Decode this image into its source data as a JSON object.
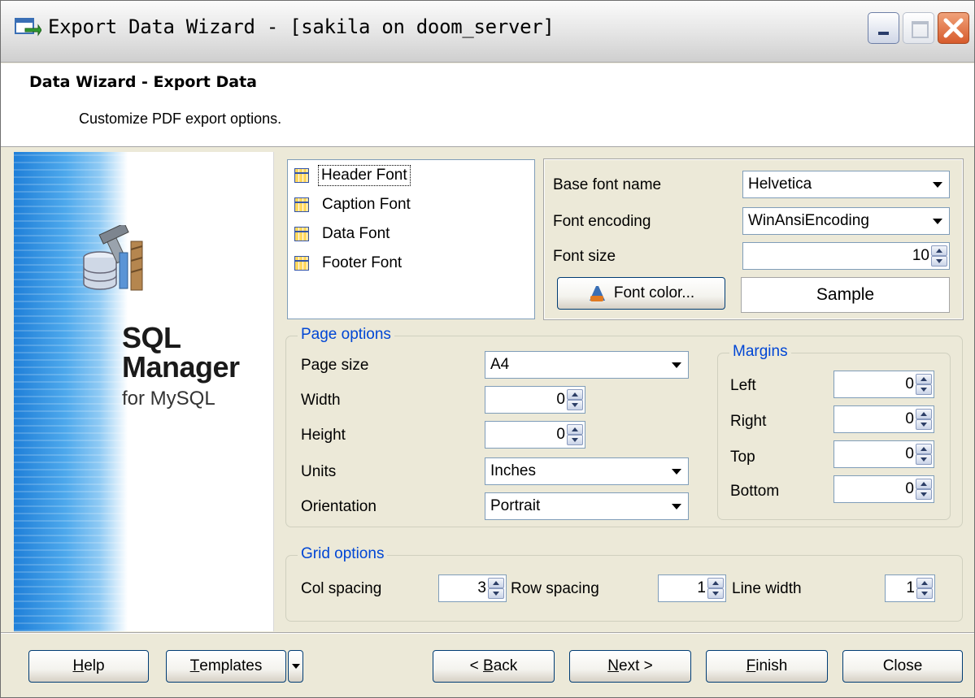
{
  "window": {
    "title": "Export Data Wizard - [sakila on doom_server]"
  },
  "header": {
    "title": "Data Wizard - Export Data",
    "subtitle": "Customize PDF export options."
  },
  "side_panel": {
    "product_line1": "SQL",
    "product_line2": "Manager",
    "product_line3": "for MySQL"
  },
  "font_list": {
    "items": [
      {
        "label": "Header Font",
        "selected": true
      },
      {
        "label": "Caption Font",
        "selected": false
      },
      {
        "label": "Data Font",
        "selected": false
      },
      {
        "label": "Footer Font",
        "selected": false
      }
    ]
  },
  "font_settings": {
    "base_font_label": "Base font name",
    "base_font_value": "Helvetica",
    "encoding_label": "Font encoding",
    "encoding_value": "WinAnsiEncoding",
    "size_label": "Font size",
    "size_value": "10",
    "color_button": "Font color...",
    "sample": "Sample"
  },
  "page_options": {
    "caption": "Page options",
    "page_size_label": "Page size",
    "page_size_value": "A4",
    "width_label": "Width",
    "width_value": "0",
    "height_label": "Height",
    "height_value": "0",
    "units_label": "Units",
    "units_value": "Inches",
    "orientation_label": "Orientation",
    "orientation_value": "Portrait"
  },
  "margins": {
    "caption": "Margins",
    "left_label": "Left",
    "left_value": "0",
    "right_label": "Right",
    "right_value": "0",
    "top_label": "Top",
    "top_value": "0",
    "bottom_label": "Bottom",
    "bottom_value": "0"
  },
  "grid_options": {
    "caption": "Grid options",
    "col_spacing_label": "Col spacing",
    "col_spacing_value": "3",
    "row_spacing_label": "Row spacing",
    "row_spacing_value": "1",
    "line_width_label": "Line width",
    "line_width_value": "1"
  },
  "buttons": {
    "help_hotkey": "H",
    "help_rest": "elp",
    "templates_hotkey": "T",
    "templates_rest": "emplates",
    "back_prefix": "< ",
    "back_hotkey": "B",
    "back_rest": "ack",
    "next_hotkey": "N",
    "next_rest": "ext >",
    "finish_hotkey": "F",
    "finish_rest": "inish",
    "close": "Close"
  }
}
